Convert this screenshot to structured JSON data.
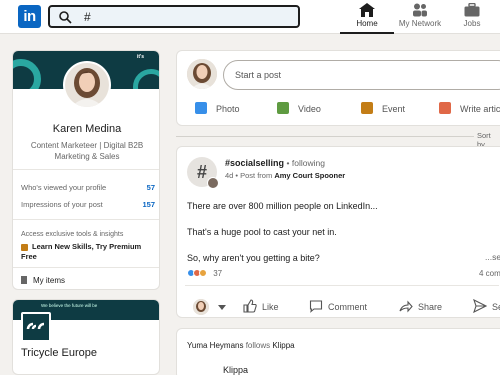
{
  "nav": {
    "logo_text": "in",
    "search_value": "#",
    "items": [
      {
        "label": "Home",
        "icon": "home-icon"
      },
      {
        "label": "My Network",
        "icon": "network-icon"
      },
      {
        "label": "Jobs",
        "icon": "briefcase-icon"
      }
    ]
  },
  "profile": {
    "name": "Karen Medina",
    "headline": "Content Marketeer | Digital B2B Marketing & Sales",
    "cover_text": "it's",
    "stats": [
      {
        "label": "Who's viewed your profile",
        "value": "57"
      },
      {
        "label": "Impressions of your post",
        "value": "157"
      }
    ],
    "access_text": "Access exclusive tools & insights",
    "premium_text": "Learn New Skills, Try Premium Free",
    "my_items": "My items"
  },
  "company": {
    "name": "Tricycle Europe",
    "cover_text": "We believe the future will be"
  },
  "share": {
    "placeholder": "Start a post",
    "actions": [
      {
        "label": "Photo",
        "icon": "photo-icon",
        "color": "#378fe9"
      },
      {
        "label": "Video",
        "icon": "video-icon",
        "color": "#5f9b41"
      },
      {
        "label": "Event",
        "icon": "event-icon",
        "color": "#c37d16"
      },
      {
        "label": "Write article",
        "icon": "article-icon",
        "color": "#e06847"
      }
    ]
  },
  "feed": {
    "sort_label": "Sort by"
  },
  "post": {
    "hashtag": "#socialselling",
    "following": "• following",
    "meta_prefix": "4d • Post from",
    "meta_author": "Amy Court Spooner",
    "lines": [
      "There are over 800 million people on LinkedIn...",
      "That's a huge pool to cast your net in.",
      "So, why aren't you getting a bite?"
    ],
    "see_more": "...see",
    "reaction_count": "37",
    "comment_count": "4 com",
    "actions": [
      {
        "label": "Like",
        "icon": "like-icon"
      },
      {
        "label": "Comment",
        "icon": "comment-icon"
      },
      {
        "label": "Share",
        "icon": "share-icon"
      },
      {
        "label": "Send",
        "icon": "send-icon"
      }
    ]
  },
  "next_post": {
    "actor": "Yuma Heymans",
    "verb": "follows",
    "target": "Klippa",
    "title": "Klippa"
  },
  "colors": {
    "brand": "#0a66c2",
    "background": "#f3f1ee",
    "cover": "#0e3b43",
    "accent_teal": "#2aa7a1"
  }
}
